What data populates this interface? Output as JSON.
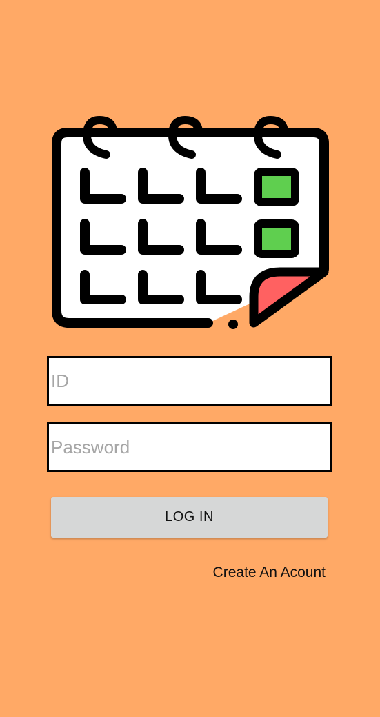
{
  "logo": {
    "icon": "calendar-icon",
    "colors": {
      "outline": "#000000",
      "page": "#FFFFFF",
      "cell": "#CCF2FC",
      "highlight": "#5FCF4F",
      "page_curl": "#FF6161"
    }
  },
  "form": {
    "id_placeholder": "ID",
    "password_placeholder": "Password",
    "login_label": "LOG IN",
    "create_account_label": "Create An Acount"
  },
  "theme": {
    "background": "#FFA966",
    "button_background": "#D6D7D7"
  }
}
